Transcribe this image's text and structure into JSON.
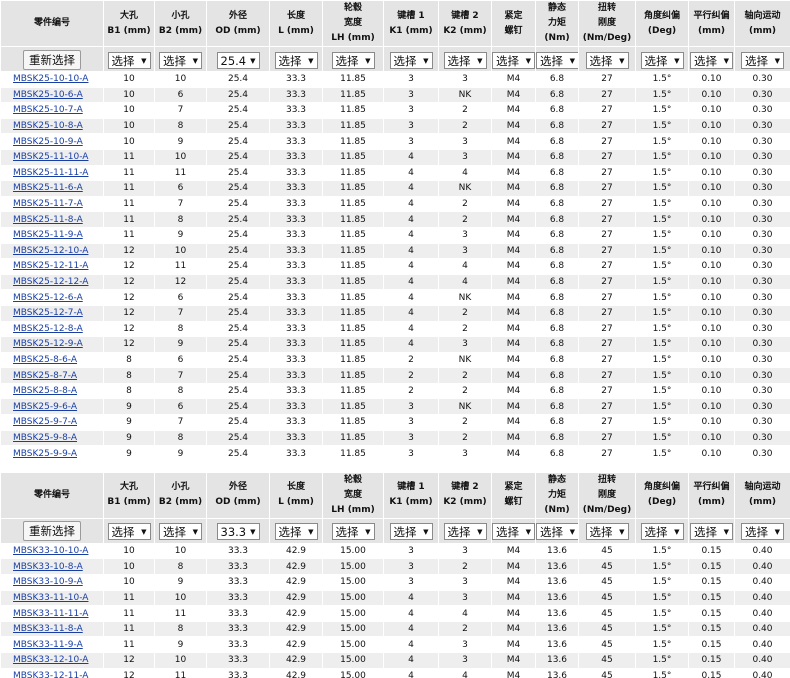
{
  "table1": {
    "headers": [
      {
        "l1": "零件编号",
        "l2": ""
      },
      {
        "l1": "大孔",
        "l2": "B1 (mm)"
      },
      {
        "l1": "小孔",
        "l2": "B2 (mm)"
      },
      {
        "l1": "外径",
        "l2": "OD (mm)"
      },
      {
        "l1": "长度",
        "l2": "L (mm)"
      },
      {
        "l1": "轮毂",
        "l2": "宽度",
        "l3": "LH (mm)"
      },
      {
        "l1": "键槽 1",
        "l2": "K1 (mm)"
      },
      {
        "l1": "键槽 2",
        "l2": "K2 (mm)"
      },
      {
        "l1": "紧定",
        "l2": "螺钉"
      },
      {
        "l1": "静态",
        "l2": "力矩",
        "l3": "(Nm)"
      },
      {
        "l1": "扭转",
        "l2": "刚度",
        "l3": "(Nm/Deg)"
      },
      {
        "l1": "角度纠偏",
        "l2": "(Deg)"
      },
      {
        "l1": "平行纠偏",
        "l2": "(mm)"
      },
      {
        "l1": "轴向运动",
        "l2": "(mm)"
      }
    ],
    "reset_label": "重新选择",
    "filters": [
      "选择",
      "选择",
      "25.4",
      "选择",
      "选择",
      "选择",
      "选择",
      "选择",
      "选择",
      "选择",
      "选择",
      "选择",
      "选择"
    ],
    "rows": [
      [
        "MBSK25-10-10-A",
        "10",
        "10",
        "25.4",
        "33.3",
        "11.85",
        "3",
        "3",
        "M4",
        "6.8",
        "27",
        "1.5°",
        "0.10",
        "0.30"
      ],
      [
        "MBSK25-10-6-A",
        "10",
        "6",
        "25.4",
        "33.3",
        "11.85",
        "3",
        "NK",
        "M4",
        "6.8",
        "27",
        "1.5°",
        "0.10",
        "0.30"
      ],
      [
        "MBSK25-10-7-A",
        "10",
        "7",
        "25.4",
        "33.3",
        "11.85",
        "3",
        "2",
        "M4",
        "6.8",
        "27",
        "1.5°",
        "0.10",
        "0.30"
      ],
      [
        "MBSK25-10-8-A",
        "10",
        "8",
        "25.4",
        "33.3",
        "11.85",
        "3",
        "2",
        "M4",
        "6.8",
        "27",
        "1.5°",
        "0.10",
        "0.30"
      ],
      [
        "MBSK25-10-9-A",
        "10",
        "9",
        "25.4",
        "33.3",
        "11.85",
        "3",
        "3",
        "M4",
        "6.8",
        "27",
        "1.5°",
        "0.10",
        "0.30"
      ],
      [
        "MBSK25-11-10-A",
        "11",
        "10",
        "25.4",
        "33.3",
        "11.85",
        "4",
        "3",
        "M4",
        "6.8",
        "27",
        "1.5°",
        "0.10",
        "0.30"
      ],
      [
        "MBSK25-11-11-A",
        "11",
        "11",
        "25.4",
        "33.3",
        "11.85",
        "4",
        "4",
        "M4",
        "6.8",
        "27",
        "1.5°",
        "0.10",
        "0.30"
      ],
      [
        "MBSK25-11-6-A",
        "11",
        "6",
        "25.4",
        "33.3",
        "11.85",
        "4",
        "NK",
        "M4",
        "6.8",
        "27",
        "1.5°",
        "0.10",
        "0.30"
      ],
      [
        "MBSK25-11-7-A",
        "11",
        "7",
        "25.4",
        "33.3",
        "11.85",
        "4",
        "2",
        "M4",
        "6.8",
        "27",
        "1.5°",
        "0.10",
        "0.30"
      ],
      [
        "MBSK25-11-8-A",
        "11",
        "8",
        "25.4",
        "33.3",
        "11.85",
        "4",
        "2",
        "M4",
        "6.8",
        "27",
        "1.5°",
        "0.10",
        "0.30"
      ],
      [
        "MBSK25-11-9-A",
        "11",
        "9",
        "25.4",
        "33.3",
        "11.85",
        "4",
        "3",
        "M4",
        "6.8",
        "27",
        "1.5°",
        "0.10",
        "0.30"
      ],
      [
        "MBSK25-12-10-A",
        "12",
        "10",
        "25.4",
        "33.3",
        "11.85",
        "4",
        "3",
        "M4",
        "6.8",
        "27",
        "1.5°",
        "0.10",
        "0.30"
      ],
      [
        "MBSK25-12-11-A",
        "12",
        "11",
        "25.4",
        "33.3",
        "11.85",
        "4",
        "4",
        "M4",
        "6.8",
        "27",
        "1.5°",
        "0.10",
        "0.30"
      ],
      [
        "MBSK25-12-12-A",
        "12",
        "12",
        "25.4",
        "33.3",
        "11.85",
        "4",
        "4",
        "M4",
        "6.8",
        "27",
        "1.5°",
        "0.10",
        "0.30"
      ],
      [
        "MBSK25-12-6-A",
        "12",
        "6",
        "25.4",
        "33.3",
        "11.85",
        "4",
        "NK",
        "M4",
        "6.8",
        "27",
        "1.5°",
        "0.10",
        "0.30"
      ],
      [
        "MBSK25-12-7-A",
        "12",
        "7",
        "25.4",
        "33.3",
        "11.85",
        "4",
        "2",
        "M4",
        "6.8",
        "27",
        "1.5°",
        "0.10",
        "0.30"
      ],
      [
        "MBSK25-12-8-A",
        "12",
        "8",
        "25.4",
        "33.3",
        "11.85",
        "4",
        "2",
        "M4",
        "6.8",
        "27",
        "1.5°",
        "0.10",
        "0.30"
      ],
      [
        "MBSK25-12-9-A",
        "12",
        "9",
        "25.4",
        "33.3",
        "11.85",
        "4",
        "3",
        "M4",
        "6.8",
        "27",
        "1.5°",
        "0.10",
        "0.30"
      ],
      [
        "MBSK25-8-6-A",
        "8",
        "6",
        "25.4",
        "33.3",
        "11.85",
        "2",
        "NK",
        "M4",
        "6.8",
        "27",
        "1.5°",
        "0.10",
        "0.30"
      ],
      [
        "MBSK25-8-7-A",
        "8",
        "7",
        "25.4",
        "33.3",
        "11.85",
        "2",
        "2",
        "M4",
        "6.8",
        "27",
        "1.5°",
        "0.10",
        "0.30"
      ],
      [
        "MBSK25-8-8-A",
        "8",
        "8",
        "25.4",
        "33.3",
        "11.85",
        "2",
        "2",
        "M4",
        "6.8",
        "27",
        "1.5°",
        "0.10",
        "0.30"
      ],
      [
        "MBSK25-9-6-A",
        "9",
        "6",
        "25.4",
        "33.3",
        "11.85",
        "3",
        "NK",
        "M4",
        "6.8",
        "27",
        "1.5°",
        "0.10",
        "0.30"
      ],
      [
        "MBSK25-9-7-A",
        "9",
        "7",
        "25.4",
        "33.3",
        "11.85",
        "3",
        "2",
        "M4",
        "6.8",
        "27",
        "1.5°",
        "0.10",
        "0.30"
      ],
      [
        "MBSK25-9-8-A",
        "9",
        "8",
        "25.4",
        "33.3",
        "11.85",
        "3",
        "2",
        "M4",
        "6.8",
        "27",
        "1.5°",
        "0.10",
        "0.30"
      ],
      [
        "MBSK25-9-9-A",
        "9",
        "9",
        "25.4",
        "33.3",
        "11.85",
        "3",
        "3",
        "M4",
        "6.8",
        "27",
        "1.5°",
        "0.10",
        "0.30"
      ]
    ]
  },
  "table2": {
    "headers": [
      {
        "l1": "零件编号",
        "l2": ""
      },
      {
        "l1": "大孔",
        "l2": "B1 (mm)"
      },
      {
        "l1": "小孔",
        "l2": "B2 (mm)"
      },
      {
        "l1": "外径",
        "l2": "OD (mm)"
      },
      {
        "l1": "长度",
        "l2": "L (mm)"
      },
      {
        "l1": "轮毂",
        "l2": "宽度",
        "l3": "LH (mm)"
      },
      {
        "l1": "键槽 1",
        "l2": "K1 (mm)"
      },
      {
        "l1": "键槽 2",
        "l2": "K2 (mm)"
      },
      {
        "l1": "紧定",
        "l2": "螺钉"
      },
      {
        "l1": "静态",
        "l2": "力矩",
        "l3": "(Nm)"
      },
      {
        "l1": "扭转",
        "l2": "刚度",
        "l3": "(Nm/Deg)"
      },
      {
        "l1": "角度纠偏",
        "l2": "(Deg)"
      },
      {
        "l1": "平行纠偏",
        "l2": "(mm)"
      },
      {
        "l1": "轴向运动",
        "l2": "(mm)"
      }
    ],
    "reset_label": "重新选择",
    "filters": [
      "选择",
      "选择",
      "33.3",
      "选择",
      "选择",
      "选择",
      "选择",
      "选择",
      "选择",
      "选择",
      "选择",
      "选择",
      "选择"
    ],
    "rows": [
      [
        "MBSK33-10-10-A",
        "10",
        "10",
        "33.3",
        "42.9",
        "15.00",
        "3",
        "3",
        "M4",
        "13.6",
        "45",
        "1.5°",
        "0.15",
        "0.40"
      ],
      [
        "MBSK33-10-8-A",
        "10",
        "8",
        "33.3",
        "42.9",
        "15.00",
        "3",
        "2",
        "M4",
        "13.6",
        "45",
        "1.5°",
        "0.15",
        "0.40"
      ],
      [
        "MBSK33-10-9-A",
        "10",
        "9",
        "33.3",
        "42.9",
        "15.00",
        "3",
        "3",
        "M4",
        "13.6",
        "45",
        "1.5°",
        "0.15",
        "0.40"
      ],
      [
        "MBSK33-11-10-A",
        "11",
        "10",
        "33.3",
        "42.9",
        "15.00",
        "4",
        "3",
        "M4",
        "13.6",
        "45",
        "1.5°",
        "0.15",
        "0.40"
      ],
      [
        "MBSK33-11-11-A",
        "11",
        "11",
        "33.3",
        "42.9",
        "15.00",
        "4",
        "4",
        "M4",
        "13.6",
        "45",
        "1.5°",
        "0.15",
        "0.40"
      ],
      [
        "MBSK33-11-8-A",
        "11",
        "8",
        "33.3",
        "42.9",
        "15.00",
        "4",
        "2",
        "M4",
        "13.6",
        "45",
        "1.5°",
        "0.15",
        "0.40"
      ],
      [
        "MBSK33-11-9-A",
        "11",
        "9",
        "33.3",
        "42.9",
        "15.00",
        "4",
        "3",
        "M4",
        "13.6",
        "45",
        "1.5°",
        "0.15",
        "0.40"
      ],
      [
        "MBSK33-12-10-A",
        "12",
        "10",
        "33.3",
        "42.9",
        "15.00",
        "4",
        "3",
        "M4",
        "13.6",
        "45",
        "1.5°",
        "0.15",
        "0.40"
      ],
      [
        "MBSK33-12-11-A",
        "12",
        "11",
        "33.3",
        "42.9",
        "15.00",
        "4",
        "4",
        "M4",
        "13.6",
        "45",
        "1.5°",
        "0.15",
        "0.40"
      ]
    ]
  }
}
